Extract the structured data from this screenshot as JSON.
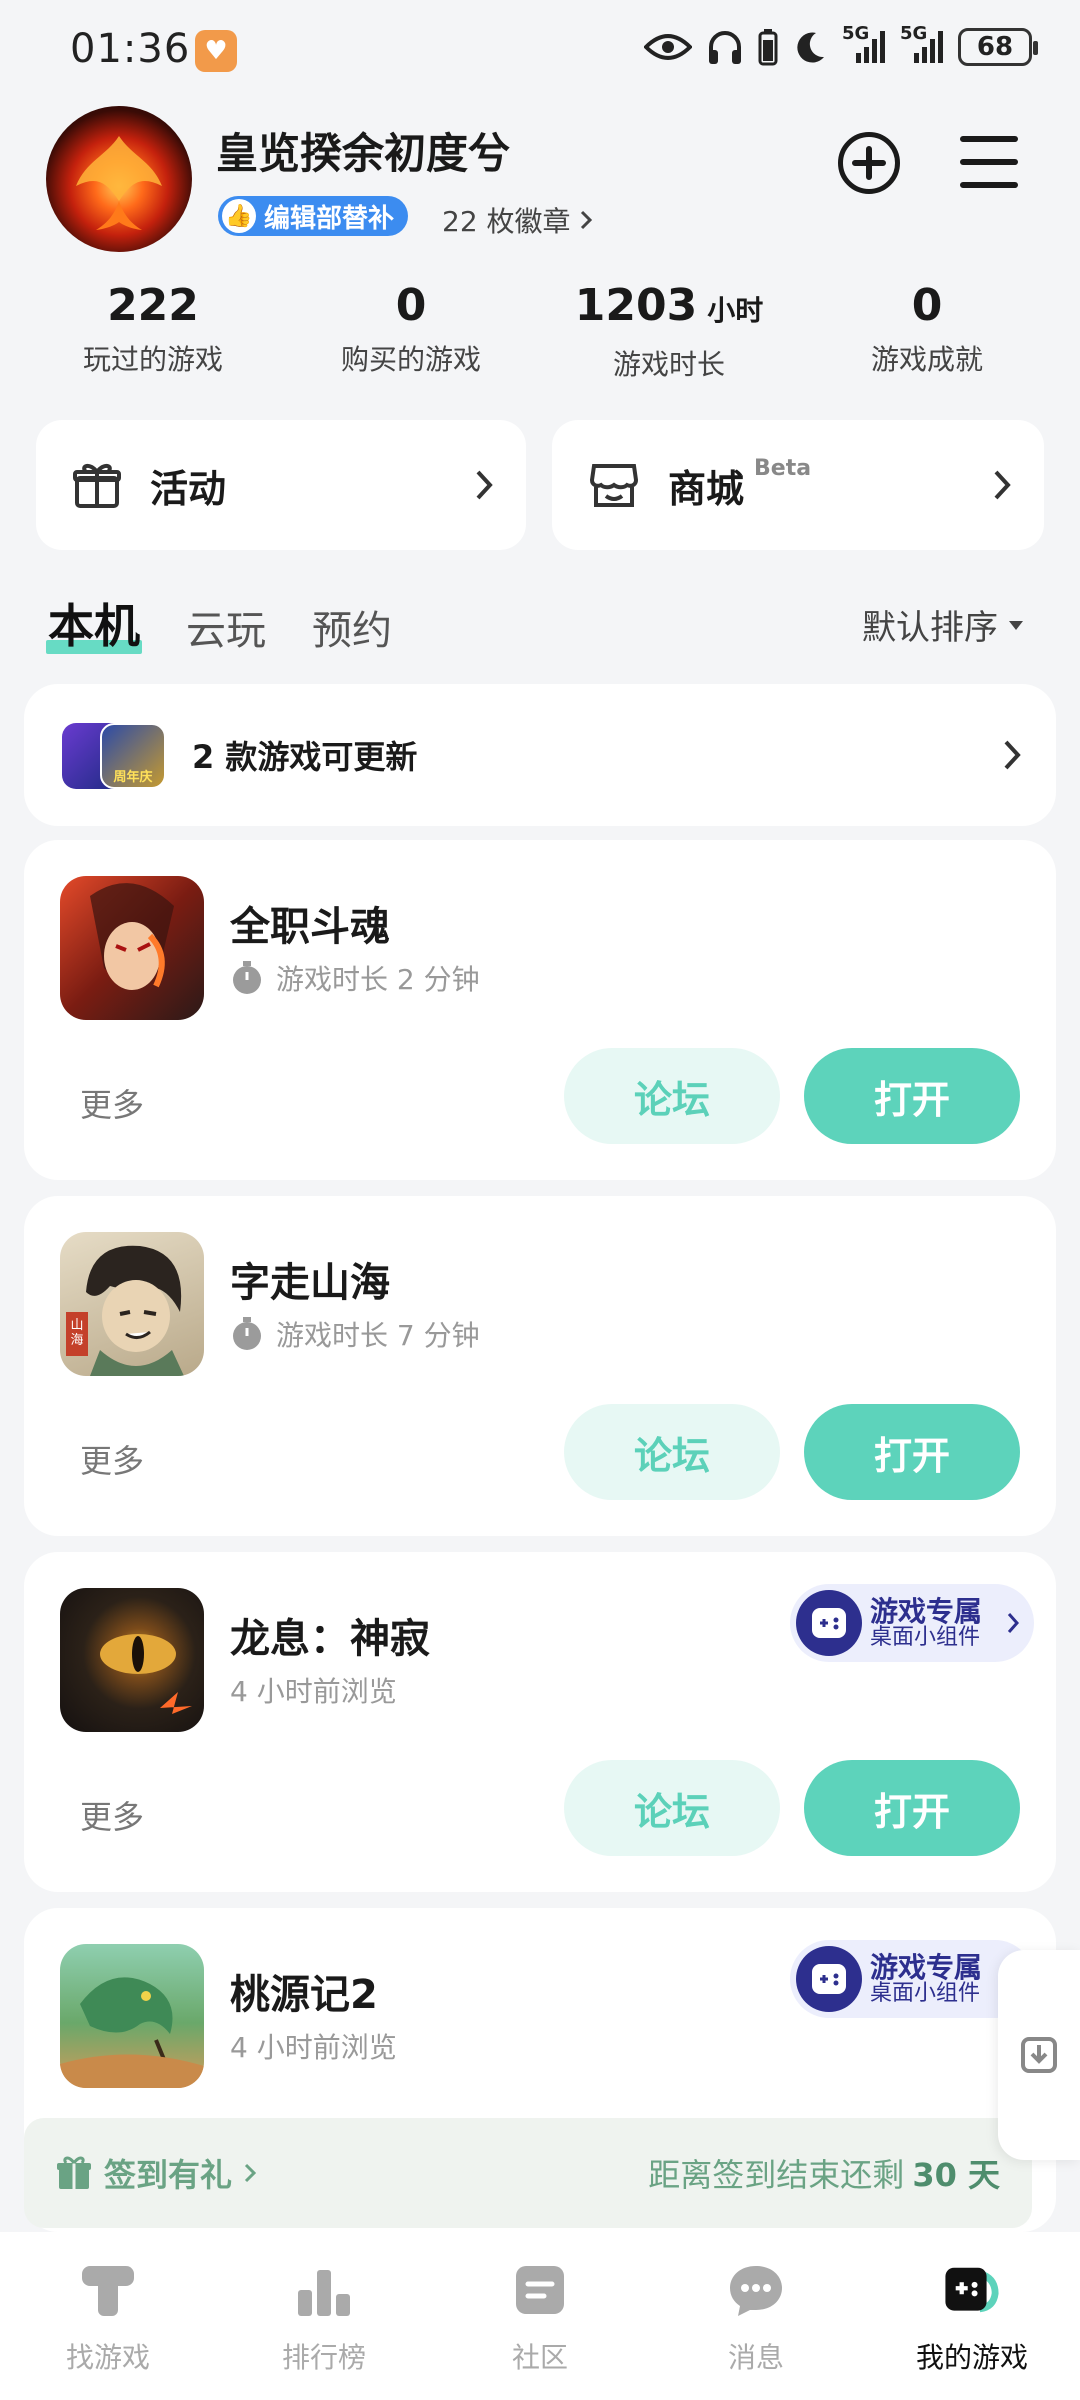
{
  "status_bar": {
    "time": "01:36",
    "battery": "68",
    "signal_1": "5G",
    "signal_2": "5G"
  },
  "profile": {
    "username": "皇览揆余初度兮",
    "badge_label": "编辑部替补",
    "medals": "22 枚徽章"
  },
  "stats": [
    {
      "value": "222",
      "unit": "",
      "label": "玩过的游戏"
    },
    {
      "value": "0",
      "unit": "",
      "label": "购买的游戏"
    },
    {
      "value": "1203",
      "unit": "小时",
      "label": "游戏时长"
    },
    {
      "value": "0",
      "unit": "",
      "label": "游戏成就"
    }
  ],
  "quick": {
    "activity": "活动",
    "mall": "商城",
    "mall_tag": "Beta"
  },
  "tabs": [
    {
      "label": "本机"
    },
    {
      "label": "云玩"
    },
    {
      "label": "预约"
    }
  ],
  "sort": "默认排序",
  "update_row": {
    "text": "2 款游戏可更新",
    "icon_caption": "周年庆"
  },
  "games": [
    {
      "name": "全职斗魂",
      "sub": "游戏时长 2 分钟",
      "more": "更多",
      "forum": "论坛",
      "open": "打开",
      "icon_color": "#b23a2a"
    },
    {
      "name": "字走山海",
      "sub": "游戏时长 7 分钟",
      "more": "更多",
      "forum": "论坛",
      "open": "打开",
      "icon_color": "#4b3a2c",
      "icon_tag": "山海"
    },
    {
      "name": "龙息：神寂",
      "sub": "4 小时前浏览",
      "more": "更多",
      "forum": "论坛",
      "open": "打开",
      "icon_color": "#3a2e22",
      "widget_t1": "游戏专属",
      "widget_t2": "桌面小组件"
    },
    {
      "name": "桃源记2",
      "sub": "4 小时前浏览",
      "icon_color": "#5c9a5a",
      "widget_t1": "游戏专属",
      "widget_t2": "桌面小组件"
    }
  ],
  "signin": {
    "label": "签到有礼",
    "remain_text": "距离签到结束还剩",
    "days": "30 天"
  },
  "nav": [
    {
      "label": "找游戏",
      "icon": "find-games-icon"
    },
    {
      "label": "排行榜",
      "icon": "ranking-icon"
    },
    {
      "label": "社区",
      "icon": "community-icon"
    },
    {
      "label": "消息",
      "icon": "message-icon"
    },
    {
      "label": "我的游戏",
      "icon": "my-games-icon"
    }
  ],
  "colors": {
    "accent": "#5dd3bb",
    "accent_light": "#e7f8f4",
    "badge": "#3c8cf0",
    "widget": "#2d2f8e",
    "signin": "#6aa384"
  }
}
